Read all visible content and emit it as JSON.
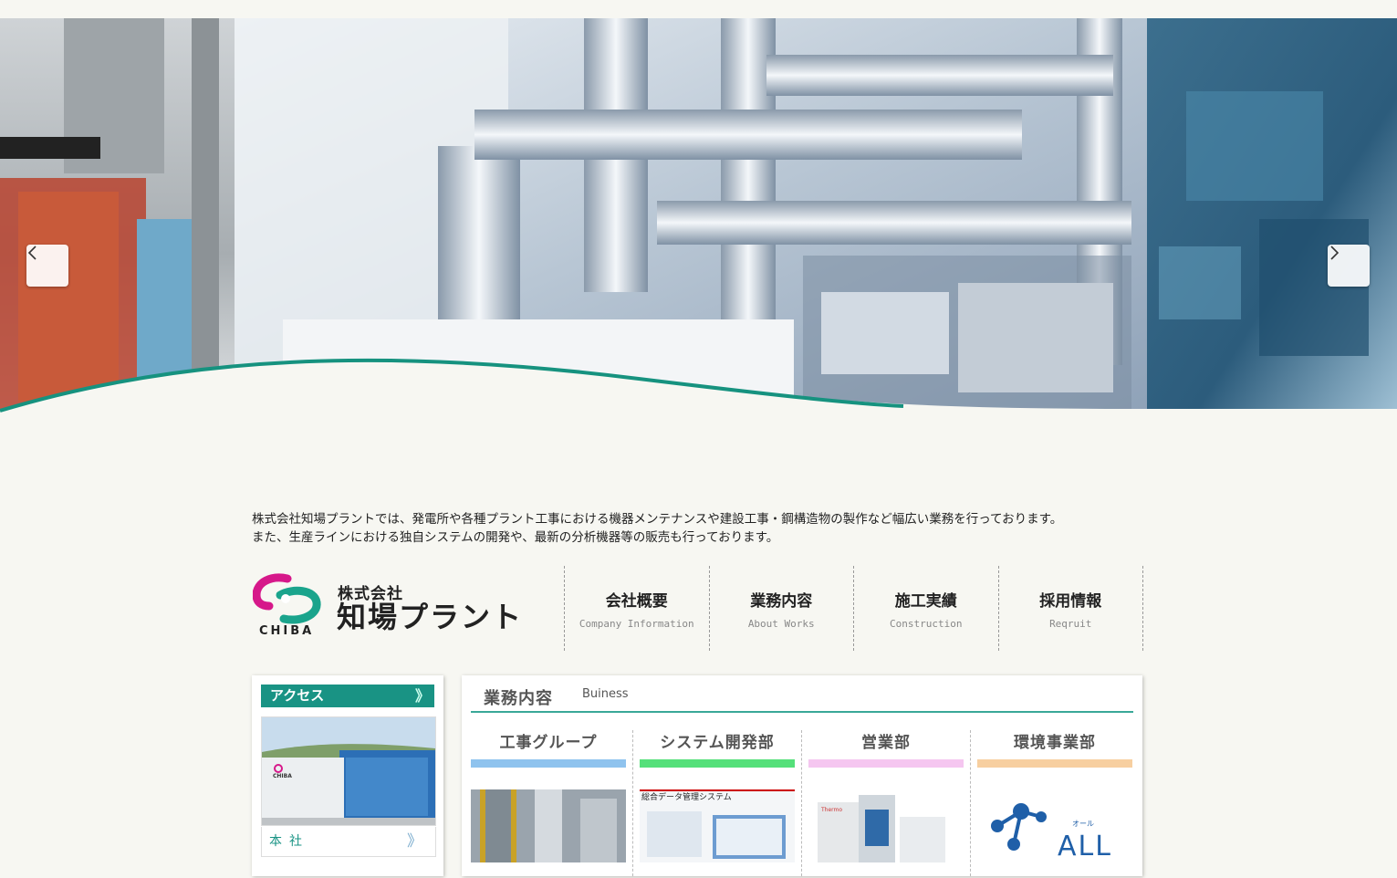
{
  "hero": {
    "prev_label": "‹",
    "next_label": "›"
  },
  "intro": {
    "line1": "株式会社知場プラントでは、発電所や各種プラント工事における機器メンテナンスや建設工事・鋼構造物の製作など幅広い業務を行っております。",
    "line2": "また、生産ラインにおける独自システムの開発や、最新の分析機器等の販売も行っております。"
  },
  "logo": {
    "mark_text": "CHIBA",
    "company_type": "株式会社",
    "company_name": "知場プラント"
  },
  "nav": [
    {
      "jp": "会社概要",
      "en": "Company Information"
    },
    {
      "jp": "業務内容",
      "en": "About Works"
    },
    {
      "jp": "施工実績",
      "en": "Construction"
    },
    {
      "jp": "採用情報",
      "en": "Reqruit"
    }
  ],
  "sidebar": {
    "access_label": "アクセス",
    "chevron": "》",
    "photo_logo_text": "CHIBA",
    "honsha_label": "本社"
  },
  "business": {
    "title": "業務内容",
    "subtitle": "Buiness",
    "departments": [
      {
        "title": "工事グループ",
        "bar_color": "#8fc3ee"
      },
      {
        "title": "システム開発部",
        "bar_color": "#55e07a"
      },
      {
        "title": "営業部",
        "bar_color": "#f5c6f0"
      },
      {
        "title": "環境事業部",
        "bar_color": "#f7cfa0"
      }
    ],
    "system_img_caption": "総合データ管理システム",
    "eigyo_brand": "Thermo",
    "env_logo_small": "オール",
    "env_logo_big": "ALL"
  },
  "colors": {
    "accent": "#199384",
    "wave": "#16927f",
    "background": "#f7f7f2"
  }
}
